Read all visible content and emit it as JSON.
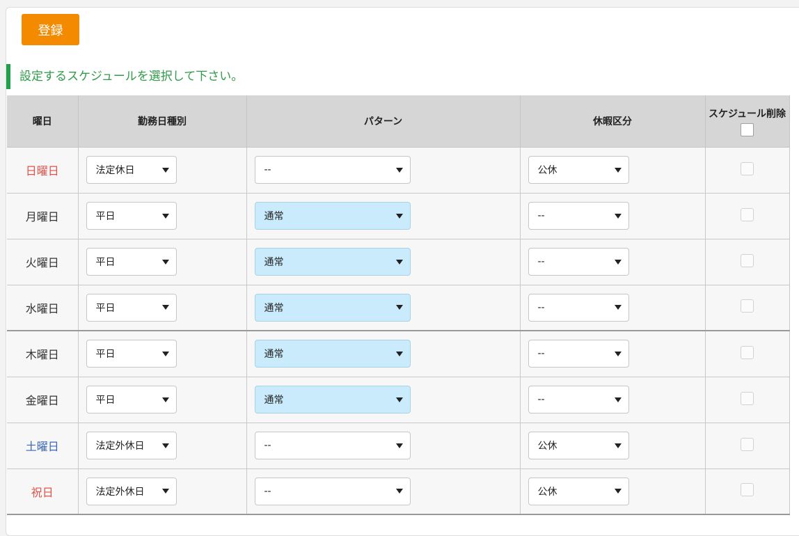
{
  "register_button": "登録",
  "instruction": "設定するスケジュールを選択して下さい。",
  "headers": {
    "day": "曜日",
    "work_type": "勤務日種別",
    "pattern": "パターン",
    "leave": "休暇区分",
    "delete": "スケジュール削除"
  },
  "rows": [
    {
      "day": "日曜日",
      "work_type": "法定休日",
      "pattern": "--",
      "leave": "公休"
    },
    {
      "day": "月曜日",
      "work_type": "平日",
      "pattern": "通常",
      "leave": "--"
    },
    {
      "day": "火曜日",
      "work_type": "平日",
      "pattern": "通常",
      "leave": "--"
    },
    {
      "day": "水曜日",
      "work_type": "平日",
      "pattern": "通常",
      "leave": "--"
    },
    {
      "day": "木曜日",
      "work_type": "平日",
      "pattern": "通常",
      "leave": "--"
    },
    {
      "day": "金曜日",
      "work_type": "平日",
      "pattern": "通常",
      "leave": "--"
    },
    {
      "day": "土曜日",
      "work_type": "法定外休日",
      "pattern": "--",
      "leave": "公休"
    },
    {
      "day": "祝日",
      "work_type": "法定外休日",
      "pattern": "--",
      "leave": "公休"
    }
  ],
  "colors": {
    "register_button": "#f38a00",
    "instruction_text": "#2f9b4a",
    "instruction_bar": "#21a04a",
    "holiday_red": "#e0524a",
    "saturday_blue": "#3a66b5",
    "pattern_highlight": "#c9ebfb",
    "header_bg": "#d6d6d6"
  }
}
